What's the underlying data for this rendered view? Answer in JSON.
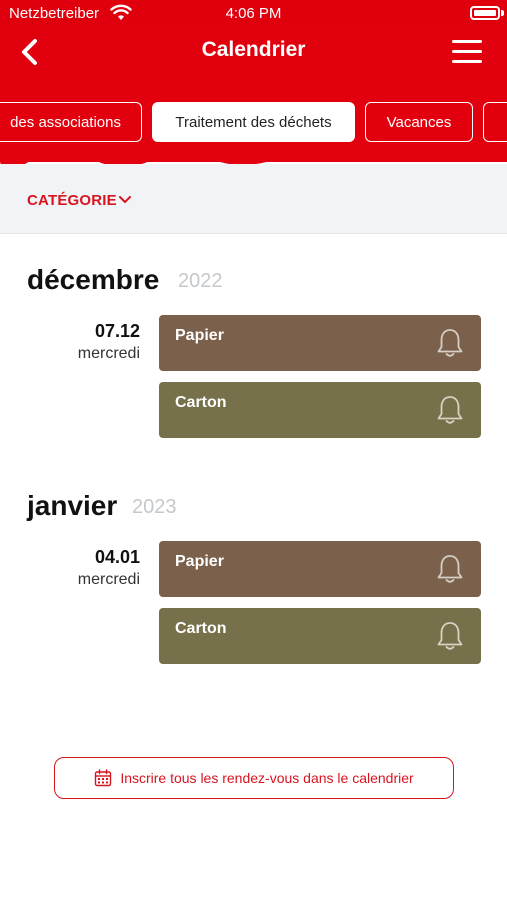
{
  "status_bar": {
    "carrier": "Netzbetreiber",
    "time": "4:06 PM"
  },
  "nav": {
    "title": "Calendrier"
  },
  "tabs": [
    {
      "label": "des associations",
      "active": false
    },
    {
      "label": "Traitement des déchets",
      "active": true
    },
    {
      "label": "Vacances",
      "active": false
    },
    {
      "label": "",
      "active": false
    }
  ],
  "filter": {
    "category_label": "CATÉGORIE"
  },
  "months": [
    {
      "name": "décembre",
      "year": "2022",
      "date": "07.12",
      "weekday": "mercredi",
      "events": [
        {
          "label": "Papier",
          "type": "papier"
        },
        {
          "label": "Carton",
          "type": "carton"
        }
      ]
    },
    {
      "name": "janvier",
      "year": "2023",
      "date": "04.01",
      "weekday": "mercredi",
      "events": [
        {
          "label": "Papier",
          "type": "papier"
        },
        {
          "label": "Carton",
          "type": "carton"
        }
      ]
    }
  ],
  "add_to_calendar": {
    "label": "Inscrire tous les rendez-vous dans le calendrier"
  },
  "colors": {
    "brand_red": "#e3000f",
    "papier": "#7b604b",
    "carton": "#76714a"
  }
}
